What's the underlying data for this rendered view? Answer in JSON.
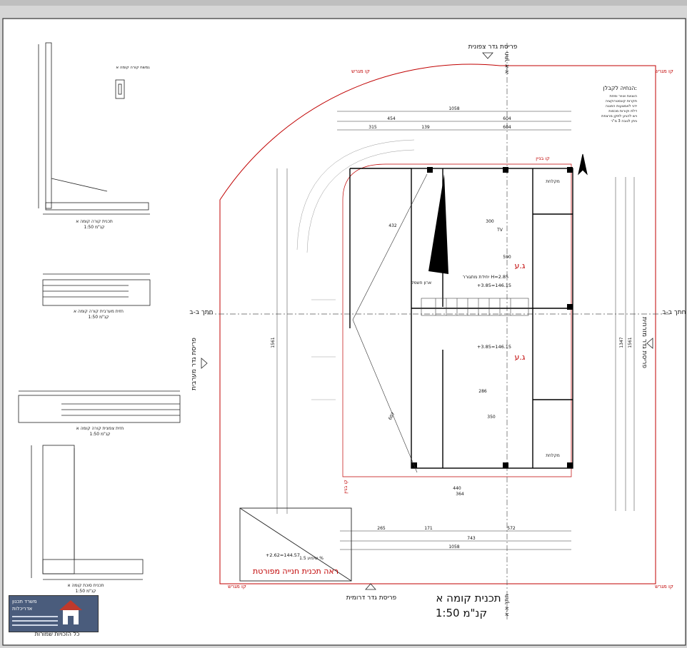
{
  "title": {
    "main": "תכנית קומה א",
    "scale": "קנ\"מ 1:50"
  },
  "fences": {
    "north": "פריסת גדר צפונית",
    "south": "פריסת גדר דרומית",
    "east": "פריסת גדר מזרחית",
    "west": "פריסת גדר מערבית"
  },
  "sections": {
    "aa": "חתך א-א",
    "bb": "חתך ב-ב"
  },
  "lines": {
    "plot": "קו מגרש",
    "building": "קו בניין"
  },
  "units": {
    "a": "ג.ע",
    "b": "ג.ע"
  },
  "rooms": {
    "kitchen_top": "מקלחת",
    "kitchen_bottom": "מקלחת",
    "balcony": "ארון חשמל",
    "tv": "TV"
  },
  "notes": {
    "heading": "הנחיה לקבלן:",
    "lines": [
      "הוצאת אוויר ופחת",
      "תקרות קונסטרוקציה",
      "ידני לאמצעות הפגנה",
      "דלת וקורות מכסות",
      "ויש להגיע לתקן מרצפת",
      "ניתן לגובה 3 מ\"ר"
    ]
  },
  "units_labels": {
    "unit_note": "יחידת מתגורר H=2.85",
    "elev1": "+3.85=146.15",
    "elev2": "+3.85=146.15",
    "elev3": "+2.62=144.57",
    "slope": "שיפוע 1.5 %"
  },
  "dims": {
    "d1058": "1058",
    "d454": "454",
    "d604": "604",
    "d315": "315",
    "d139": "139",
    "d590": "590",
    "d432": "432",
    "d300": "300",
    "d350": "350",
    "d286": "286",
    "d440": "440",
    "d364": "364",
    "d743": "743",
    "d572": "572",
    "d171": "171",
    "d265": "265",
    "d1561": "1561",
    "d1347": "1347",
    "d607": "607"
  },
  "side_details": {
    "detail1_title": "תכנית קורה קומה א",
    "detail1_scale": "קנ\"מ 1:50",
    "detail2_title": "חזית מערבית קורה קומה א",
    "detail2_scale": "קנ\"מ 1:50",
    "detail3_title": "חזית צפונית קורה קומה א",
    "detail3_scale": "קנ\"מ 1:50",
    "detail4_title": "תכנית סוכת קומה א",
    "detail4_scale": "קנ\"מ 1:50",
    "detail_top": "גמשח קורה קומה א"
  },
  "see_plan": "ראה תכנית חנייה מפורטת",
  "copyright": "כל הזכויות שמורות",
  "stamp": {
    "line1": "משרד תכנון",
    "line2": "אדריכלות"
  },
  "colors": {
    "plot_line": "#c00000",
    "ink": "#111111",
    "wall": "#000000"
  }
}
